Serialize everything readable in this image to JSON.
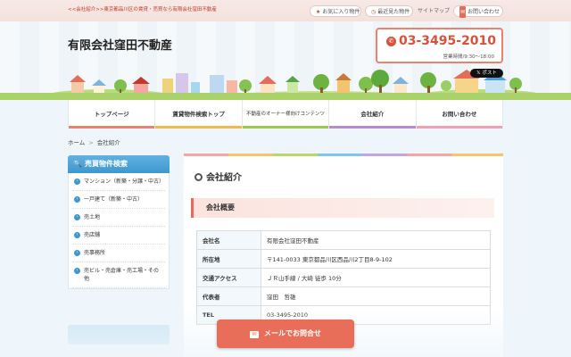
{
  "topbar": {
    "tagline": "<<会社紹介>>東京都品川区の賃貸・売買なら有限会社窪田不動産",
    "favorites": "お気に入り物件",
    "recent": "最近見た物件",
    "sitemap": "サイトマップ",
    "contact": "お問い合わせ"
  },
  "header": {
    "company": "有限会社窪田不動産",
    "phone": "03-3495-2010",
    "hours": "営業時間/9:30～18:00",
    "post_button": "ポスト"
  },
  "nav": {
    "items": [
      {
        "label": "トップページ",
        "color": "#e9836f"
      },
      {
        "label": "賃貸物件検索トップ",
        "color": "#f3b94c"
      },
      {
        "label": "不動産のオーナー様向けコンテンツ",
        "color": "#9acb4f"
      },
      {
        "label": "会社紹介",
        "color": "#b48ad8"
      },
      {
        "label": "お問い合わせ",
        "color": "#f09fb4"
      }
    ]
  },
  "breadcrumb": {
    "home": "ホーム",
    "separator": ">",
    "current": "会社紹介"
  },
  "sidebar": {
    "title": "売買物件検索",
    "items": [
      "マンション（新築・分譲・中古）",
      "一戸建て（新築・中古）",
      "売土地",
      "売店舗",
      "売事務所",
      "売ビル・売倉庫・売工場・その他"
    ]
  },
  "main": {
    "title": "会社紹介",
    "section": "会社概要",
    "rows": [
      {
        "key": "会社名",
        "value": "有限会社窪田不動産"
      },
      {
        "key": "所在地",
        "value": "〒141-0033 東京都品川区西品川2丁目8-9-102"
      },
      {
        "key": "交通アクセス",
        "value": "ＪＲ山手線 / 大崎 徒歩 10分"
      },
      {
        "key": "代表者",
        "value": "窪田　哲雄"
      },
      {
        "key": "TEL",
        "value": "03-3495-2010"
      }
    ]
  },
  "cta": {
    "label": "メールでお問合せ"
  },
  "colors": {
    "accent": "#e96e59",
    "blue": "#3d97cf",
    "phone": "#d9503b"
  }
}
